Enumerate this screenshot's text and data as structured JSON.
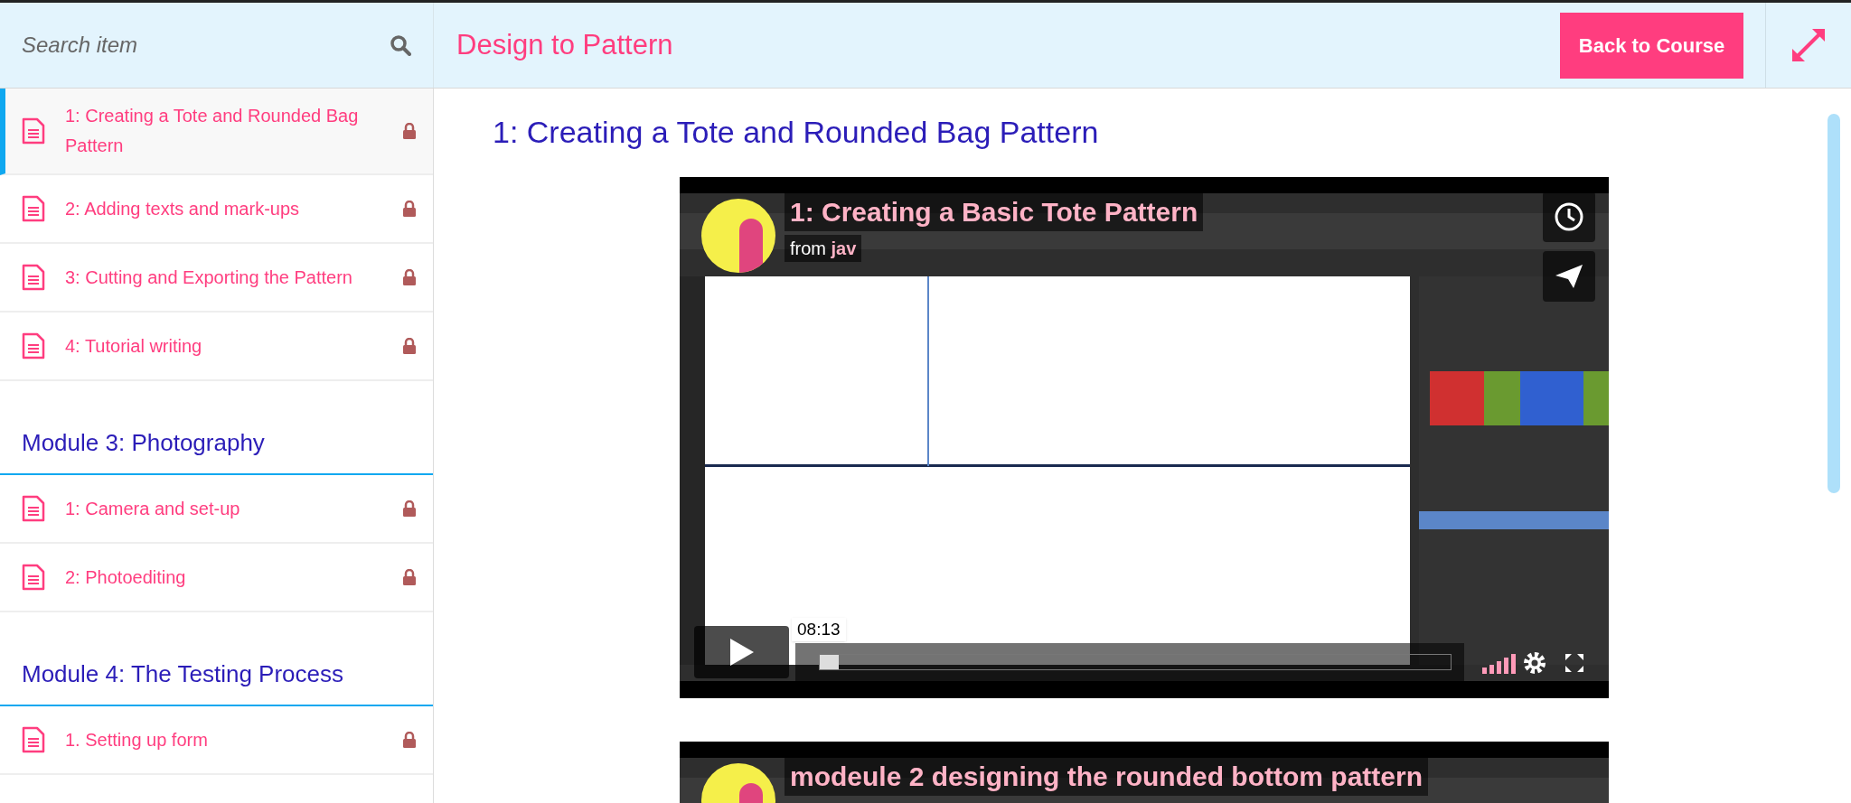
{
  "header": {
    "search_placeholder": "Search item",
    "course_title": "Design to Pattern",
    "back_button": "Back to Course"
  },
  "sidebar": {
    "items": [
      {
        "kind": "lesson",
        "title": "1: Creating a Tote and Rounded Bag Pattern",
        "selected": true,
        "locked": true
      },
      {
        "kind": "lesson",
        "title": "2: Adding texts and mark-ups",
        "selected": false,
        "locked": true
      },
      {
        "kind": "lesson",
        "title": "3: Cutting and Exporting the Pattern",
        "selected": false,
        "locked": true
      },
      {
        "kind": "lesson",
        "title": "4: Tutorial writing",
        "selected": false,
        "locked": true
      },
      {
        "kind": "module",
        "title": "Module 3: Photography"
      },
      {
        "kind": "lesson",
        "title": "1: Camera and set-up",
        "selected": false,
        "locked": true
      },
      {
        "kind": "lesson",
        "title": "2: Photoediting",
        "selected": false,
        "locked": true
      },
      {
        "kind": "module",
        "title": "Module 4: The Testing Process"
      },
      {
        "kind": "lesson",
        "title": "1. Setting up form",
        "selected": false,
        "locked": true
      }
    ]
  },
  "lesson_title": "1: Creating a Tote and Rounded Bag Pattern",
  "videos": [
    {
      "title": "1: Creating a Basic Tote Pattern",
      "byline": "from **jav**",
      "time": "08:13",
      "progress": {
        "level": 0.03
      }
    },
    {
      "title": "modeule 2 designing the rounded bottom pattern"
    }
  ]
}
